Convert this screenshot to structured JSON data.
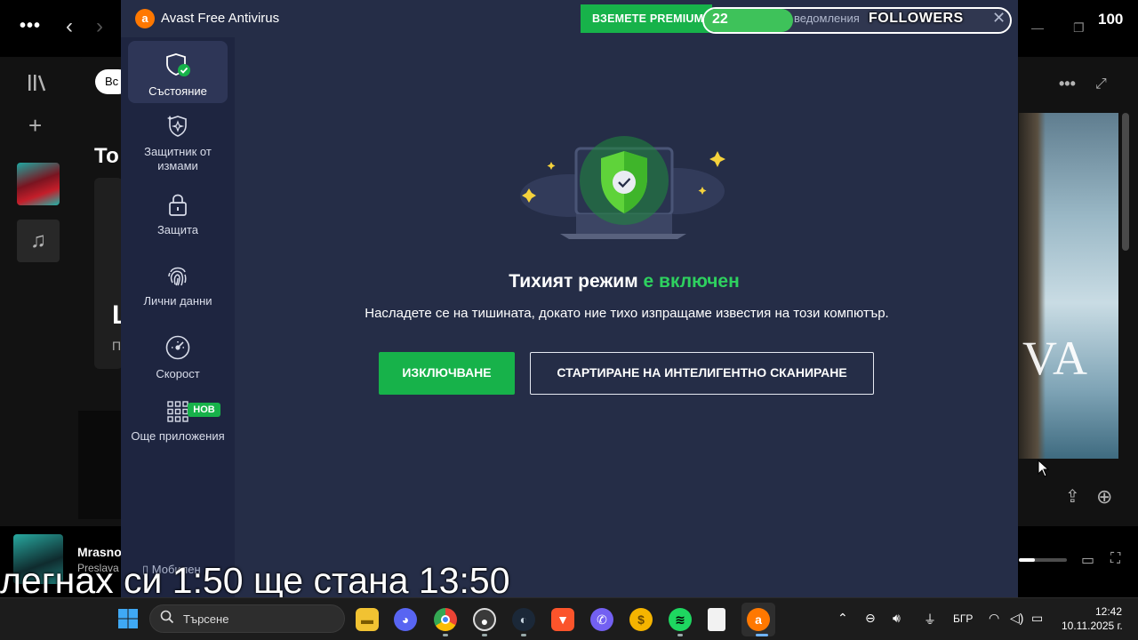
{
  "spotify": {
    "chip_label": "Вс",
    "section_heading": "То",
    "card_letter": "L",
    "card_sub": "П",
    "now_playing": {
      "title": "Mrasno",
      "artist": "Preslava"
    },
    "album_text": "VA"
  },
  "avast": {
    "app_title": "Avast Free Antivirus",
    "premium_button": "ВЗЕМЕТЕ PREMIUM",
    "notifications": "ведомления",
    "nav": [
      {
        "label": "Състояние",
        "icon": "shield-check-icon",
        "active": true
      },
      {
        "label": "Защитник от измами",
        "icon": "shield-scam-icon",
        "active": false
      },
      {
        "label": "Защита",
        "icon": "lock-icon",
        "active": false
      },
      {
        "label": "Лични данни",
        "icon": "fingerprint-icon",
        "active": false
      },
      {
        "label": "Скорост",
        "icon": "speedometer-icon",
        "active": false
      },
      {
        "label": "Още приложения",
        "icon": "apps-grid-icon",
        "active": false
      }
    ],
    "new_badge": "НОВ",
    "mobile_label": "Мобилен",
    "heading_white": "Тихият режим",
    "heading_green": "е включен",
    "subtitle": "Насладете се на тишината, докато ние тихо изпращаме известия на този компютър.",
    "btn_disable": "ИЗКЛЮЧВАНЕ",
    "btn_scan": "СТАРТИРАНЕ НА ИНТЕЛИГЕНТНО СКАНИРАНЕ",
    "colors": {
      "bg": "#252d47",
      "sidebar": "#1e2540",
      "accent_green": "#17b24a",
      "text_green": "#2ed15f"
    }
  },
  "overlay": {
    "followers_label": "FOLLOWERS",
    "followers_current": "22",
    "followers_goal": "100",
    "caption": "легнах си 1:50 ще стана 13:50"
  },
  "taskbar": {
    "search_placeholder": "Търсене",
    "apps": [
      "file-explorer-icon",
      "discord-icon",
      "chrome-icon",
      "obs-icon",
      "steam-icon",
      "brave-icon",
      "viber-icon",
      "coin-icon",
      "spotify-icon",
      "file-icon",
      "avast-icon"
    ],
    "language": "БГР",
    "time": "12:42",
    "date": "10.11.2025 г."
  }
}
